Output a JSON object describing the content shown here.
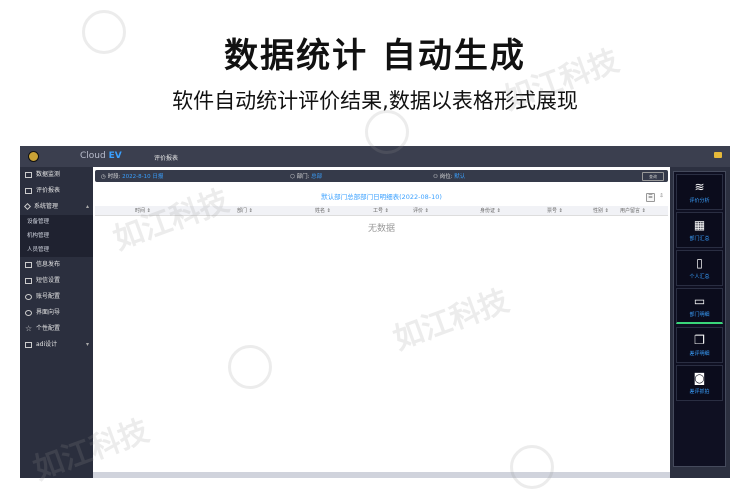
{
  "banner": {
    "headline": "数据统计  自动生成",
    "subline": "软件自动统计评价结果,数据以表格形式展现",
    "watermark": "如江科技"
  },
  "app": {
    "brand_prefix": "Cloud",
    "brand_suffix": "EV",
    "top_tab": "评价报表"
  },
  "sidebar": {
    "items": [
      {
        "label": "数据监测",
        "icon": "play-icon"
      },
      {
        "label": "评价报表",
        "icon": "report-icon"
      },
      {
        "label": "系统管理",
        "icon": "diamond-icon"
      },
      {
        "label": "信息发布",
        "icon": "inbox-icon"
      },
      {
        "label": "短信设置",
        "icon": "phone-icon"
      },
      {
        "label": "账号配置",
        "icon": "gear-icon"
      },
      {
        "label": "界面向导",
        "icon": "check-circle-icon"
      },
      {
        "label": "个性配置",
        "icon": "star-icon"
      },
      {
        "label": "adi设计",
        "icon": "monitor-icon"
      }
    ],
    "sub_items": [
      "设备管理",
      "机构管理",
      "人员管理"
    ]
  },
  "filter": {
    "time_label": "时段:",
    "time_value": "2022-8-10 日报",
    "dept_label": "部门:",
    "dept_value": "总部",
    "post_label": "岗位:",
    "post_value": "默认",
    "button_label": "查询"
  },
  "table": {
    "title": "默认部门总部部门日明细表(2022-08-10)",
    "headers": [
      "时间 ⇕",
      "部门 ⇕",
      "姓名 ⇕",
      "工号 ⇕",
      "评价 ⇕",
      "身份证 ⇕",
      "票号 ⇕",
      "性别 ⇕",
      "用户留言 ⇕"
    ],
    "empty_text": "无数据"
  },
  "right_panel": {
    "buttons": [
      {
        "label": "评价分析",
        "icon": "layers-icon"
      },
      {
        "label": "部门汇总",
        "icon": "grid-icon"
      },
      {
        "label": "个人汇总",
        "icon": "book-icon"
      },
      {
        "label": "部门明细",
        "icon": "window-icon"
      },
      {
        "label": "差评明细",
        "icon": "copy-icon"
      },
      {
        "label": "差评抓拍",
        "icon": "camera-icon"
      }
    ]
  }
}
